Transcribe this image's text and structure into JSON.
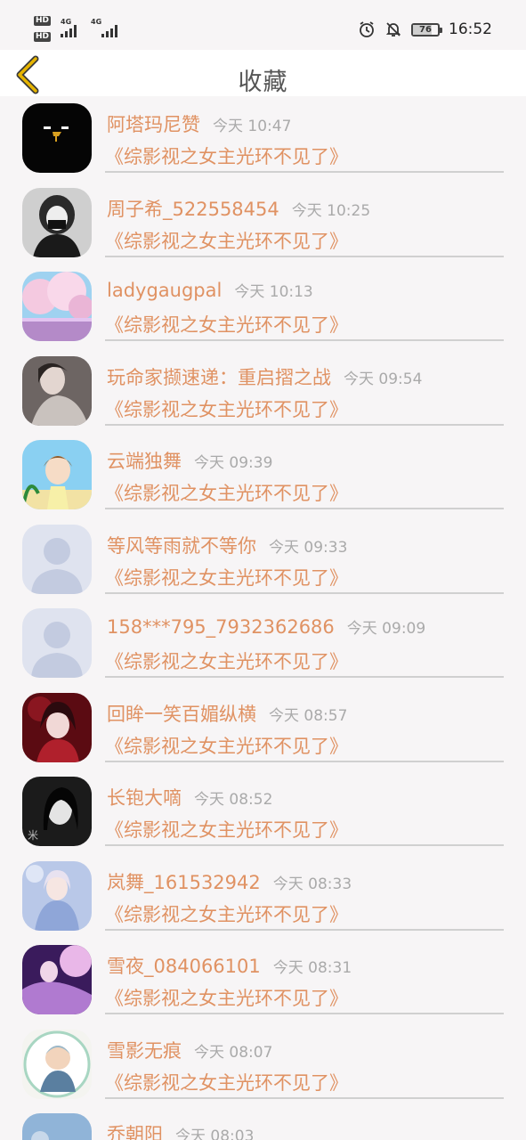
{
  "status_bar": {
    "left_labels": [
      "HD",
      "HD"
    ],
    "signal_labels": [
      "4G",
      "4G"
    ],
    "battery": "76",
    "battery_level": 0.76,
    "time": "16:52",
    "icons": [
      "alarm-icon",
      "bell-off-icon"
    ]
  },
  "nav": {
    "title": "收藏",
    "back_icon": "chevron-left-icon",
    "accent_color": "#e6b400"
  },
  "colors": {
    "accent": "#e09263",
    "timestamp": "#aaaaaa",
    "background": "#f7f5f6"
  },
  "items": [
    {
      "name": "阿塔玛尼赞",
      "time": "今天 10:47",
      "book": "《综影视之女主光环不见了》",
      "avatar": "black-face"
    },
    {
      "name": "周子希_522558454",
      "time": "今天 10:25",
      "book": "《综影视之女主光环不见了》",
      "avatar": "masked-girl"
    },
    {
      "name": "ladygaugpal",
      "time": "今天 10:13",
      "book": "《综影视之女主光环不见了》",
      "avatar": "cherry-blossom"
    },
    {
      "name": "玩命家撷速递：重启摺之战",
      "time": "今天 09:54",
      "book": "《综影视之女主光环不见了》",
      "avatar": "woman-portrait"
    },
    {
      "name": "云端独舞",
      "time": "今天 09:39",
      "book": "《综影视之女主光环不见了》",
      "avatar": "cartoon-girl"
    },
    {
      "name": "等风等雨就不等你",
      "time": "今天 09:33",
      "book": "《综影视之女主光环不见了》",
      "avatar": "default"
    },
    {
      "name": "158***795_7932362686",
      "time": "今天 09:09",
      "book": "《综影视之女主光环不见了》",
      "avatar": "default"
    },
    {
      "name": "回眸一笑百媚纵横",
      "time": "今天 08:57",
      "book": "《综影视之女主光环不见了》",
      "avatar": "red-anime"
    },
    {
      "name": "长铇大嘀",
      "time": "今天 08:52",
      "book": "《综影视之女主光环不见了》",
      "avatar": "bw-girl"
    },
    {
      "name": "岚舞_161532942",
      "time": "今天 08:33",
      "book": "《综影视之女主光环不见了》",
      "avatar": "doll"
    },
    {
      "name": "雪夜_084066101",
      "time": "今天 08:31",
      "book": "《综影视之女主光环不见了》",
      "avatar": "purple-art"
    },
    {
      "name": "雪影无痕",
      "time": "今天 08:07",
      "book": "《综影视之女主光环不见了》",
      "avatar": "baby"
    },
    {
      "name": "乔朝阳",
      "time": "今天 08:03",
      "book": "",
      "avatar": "partial"
    }
  ]
}
